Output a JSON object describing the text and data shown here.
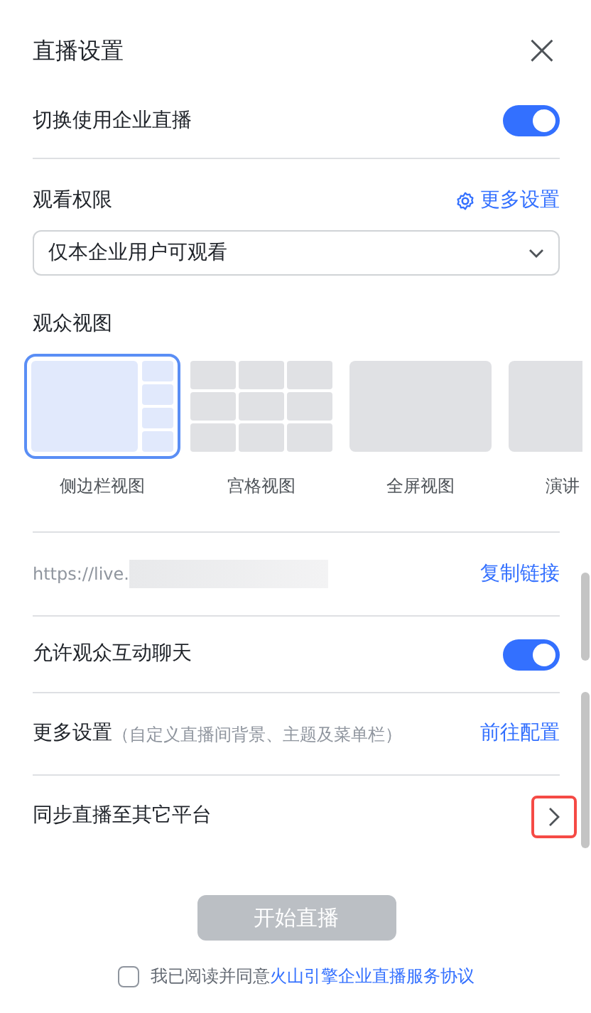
{
  "dialog": {
    "title": "直播设置",
    "close": "×"
  },
  "enterprise_toggle": {
    "label": "切换使用企业直播",
    "on": true
  },
  "permission": {
    "label": "观看权限",
    "more_link": "更多设置",
    "value": "仅本企业用户可观看"
  },
  "audience_view": {
    "label": "观众视图",
    "layouts": [
      {
        "label": "侧边栏视图",
        "kind": "sidebar",
        "selected": true
      },
      {
        "label": "宫格视图",
        "kind": "grid",
        "selected": false
      },
      {
        "label": "全屏视图",
        "kind": "full",
        "selected": false
      },
      {
        "label": "演讲",
        "kind": "full",
        "selected": false
      }
    ]
  },
  "link": {
    "url": "https://live.",
    "action": "复制链接"
  },
  "chat_toggle": {
    "label": "允许观众互动聊天",
    "on": true
  },
  "more_settings": {
    "label": "更多设置",
    "hint": "（自定义直播间背景、主题及菜单栏）",
    "action": "前往配置"
  },
  "sync": {
    "label": "同步直播至其它平台",
    "highlighted": true
  },
  "start_button": {
    "label": "开始直播",
    "disabled": true
  },
  "agreement": {
    "text": "我已阅读并同意",
    "link": "火山引擎企业直播服务协议",
    "checked": false
  }
}
